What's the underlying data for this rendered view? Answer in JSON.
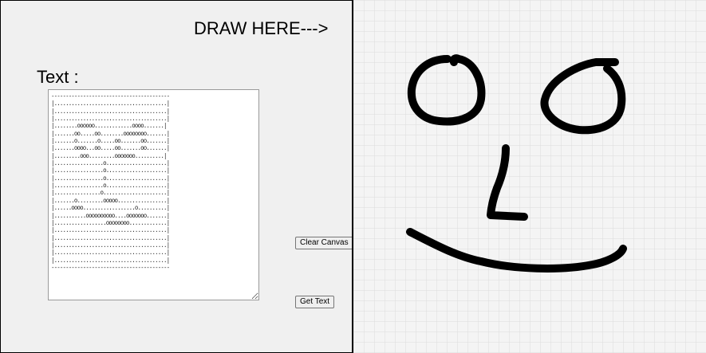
{
  "left_panel": {
    "draw_here": "DRAW HERE--->",
    "text_label": "Text :",
    "ascii_text": "-----------------------------------------\n|.......................................|\n|.......................................|\n|.......................................|\n|........oooooo.............oooo.......|\n|.......oo.....oo........oooooooo.......|\n|.......o.......o.....oo.......oo.......|\n|.......oooo...oo.....oo.......oo.......|\n|.........ooo.........ooooooo..........|\n|.................o.....................|\n|.................o.....................|\n|.................o.....................|\n|.................o.....................|\n|................o......................|\n|.......o.........ooooo.................|\n|......oooo..................o..........|\n|...........oooooooooo....ooooooo.......|\n|..................oooooooo.............|\n|.......................................|\n|.......................................|\n|.......................................|\n|.......................................|\n|.......................................|\n-----------------------------------------",
    "clear_button": "Clear Canvas",
    "get_text_button": "Get Text"
  },
  "canvas": {
    "background": "#f4f4f4",
    "grid_color": "#dcdcdc",
    "stroke_color": "#000000"
  }
}
